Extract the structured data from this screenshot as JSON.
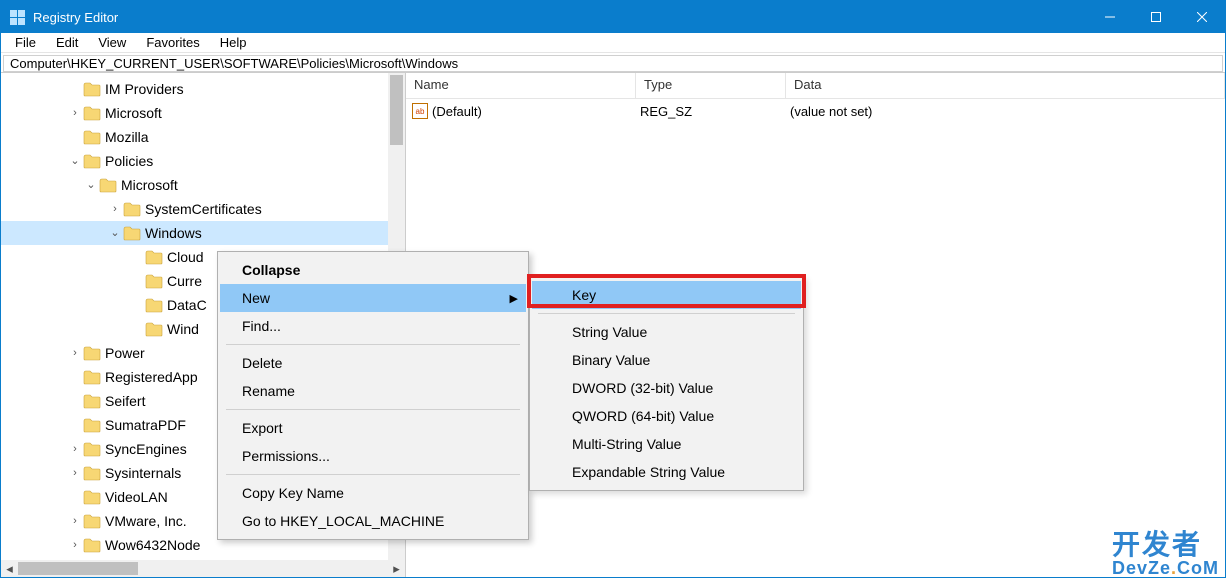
{
  "title": "Registry Editor",
  "menus": [
    "File",
    "Edit",
    "View",
    "Favorites",
    "Help"
  ],
  "address": "Computer\\HKEY_CURRENT_USER\\SOFTWARE\\Policies\\Microsoft\\Windows",
  "tree": [
    {
      "indent": 1,
      "exp": "",
      "label": "IM Providers"
    },
    {
      "indent": 1,
      "exp": "›",
      "label": "Microsoft"
    },
    {
      "indent": 1,
      "exp": "",
      "label": "Mozilla"
    },
    {
      "indent": 1,
      "exp": "v",
      "label": "Policies"
    },
    {
      "indent": 2,
      "exp": "v",
      "label": "Microsoft"
    },
    {
      "indent": 3,
      "exp": "›",
      "label": "SystemCertificates"
    },
    {
      "indent": 3,
      "exp": "v",
      "label": "Windows",
      "selected": true
    },
    {
      "indent": 4,
      "exp": "",
      "label": "Cloud"
    },
    {
      "indent": 4,
      "exp": "",
      "label": "Curre"
    },
    {
      "indent": 4,
      "exp": "",
      "label": "DataC"
    },
    {
      "indent": 4,
      "exp": "",
      "label": "Wind"
    },
    {
      "indent": 1,
      "exp": "›",
      "label": "Power"
    },
    {
      "indent": 1,
      "exp": "",
      "label": "RegisteredApp"
    },
    {
      "indent": 1,
      "exp": "",
      "label": "Seifert"
    },
    {
      "indent": 1,
      "exp": "",
      "label": "SumatraPDF"
    },
    {
      "indent": 1,
      "exp": "›",
      "label": "SyncEngines"
    },
    {
      "indent": 1,
      "exp": "›",
      "label": "Sysinternals"
    },
    {
      "indent": 1,
      "exp": "",
      "label": "VideoLAN"
    },
    {
      "indent": 1,
      "exp": "›",
      "label": "VMware, Inc."
    },
    {
      "indent": 1,
      "exp": "›",
      "label": "Wow6432Node"
    }
  ],
  "list": {
    "cols": {
      "name": "Name",
      "type": "Type",
      "data": "Data"
    },
    "rows": [
      {
        "name": "(Default)",
        "type": "REG_SZ",
        "data": "(value not set)"
      }
    ]
  },
  "ctx": {
    "collapse": "Collapse",
    "new": "New",
    "find": "Find...",
    "delete": "Delete",
    "rename": "Rename",
    "export": "Export",
    "permissions": "Permissions...",
    "copykey": "Copy Key Name",
    "goto": "Go to HKEY_LOCAL_MACHINE"
  },
  "sub": {
    "key": "Key",
    "string": "String Value",
    "binary": "Binary Value",
    "dword": "DWORD (32-bit) Value",
    "qword": "QWORD (64-bit) Value",
    "multi": "Multi-String Value",
    "expand": "Expandable String Value"
  },
  "watermark": {
    "cn": "开发者",
    "en_prefix": "DevZe",
    "en_dot": ".",
    "en_suffix": "CoM"
  }
}
